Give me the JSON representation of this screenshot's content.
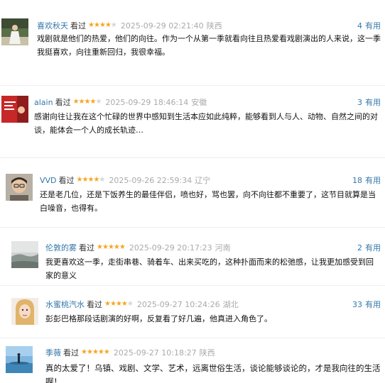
{
  "reviews": [
    {
      "user": "喜欢秋天",
      "watched": "看过",
      "rating": 4,
      "time": "2025-09-29 02:21:40",
      "location": "陕西",
      "useful_count": "4",
      "useful_label": "有用",
      "content": "戏剧就是他们的热爱，他们的向往。作为一个从第一季就看向往且热爱看戏剧演出的人来说，这一季我挺喜欢，向往重新回归，我很幸福。",
      "avatar_icon": "user-avatar-photo"
    },
    {
      "user": "alain",
      "watched": "看过",
      "rating": 4,
      "time": "2025-09-29 18:46:14",
      "location": "安徽",
      "useful_count": "3",
      "useful_label": "有用",
      "content": "感谢向往让我在这个忙碌的世界中感知到生活本应如此纯粹，能够看到人与人、动物、自然之间的对谈，能体会一个人的成长轨迹…",
      "avatar_icon": "user-avatar-photo"
    },
    {
      "user": "VVD",
      "watched": "看过",
      "rating": 4,
      "time": "2025-09-26 22:59:34",
      "location": "辽宁",
      "useful_count": "18",
      "useful_label": "有用",
      "content": "还是老几位，还是下饭养生的最佳伴侣，喷也好，骂也罢，向不向往都不重要了，这节目就算是当白噪音，也得有。",
      "avatar_icon": "user-avatar-photo"
    },
    {
      "user": "伦敦的雾",
      "watched": "看过",
      "rating": 5,
      "time": "2025-09-29 20:17:23",
      "location": "河南",
      "useful_count": "2",
      "useful_label": "有用",
      "content": "我更喜欢这一季，走街串巷、骑着车、出来买吃的，这种扑面而来的松弛感，让我更加感受到回家的意义",
      "avatar_icon": "user-avatar-photo"
    },
    {
      "user": "水蜜桃汽水",
      "watched": "看过",
      "rating": 4,
      "time": "2025-09-27 10:24:26",
      "location": "湖北",
      "useful_count": "33",
      "useful_label": "有用",
      "content": "彭彭巴格那段话剧演的好啊，反复看了好几遍，他真进入角色了。",
      "avatar_icon": "user-avatar-photo"
    },
    {
      "user": "季薇",
      "watched": "看过",
      "rating": 5,
      "time": "2025-09-27 10:18:27",
      "location": "陕西",
      "useful_count": "",
      "useful_label": "",
      "content": "真的太爱了！乌镇、戏剧、文学、艺术，远离世俗生活，谈论能够谈论的，才是我向往的生活啊！",
      "avatar_icon": "user-avatar-photo"
    }
  ]
}
